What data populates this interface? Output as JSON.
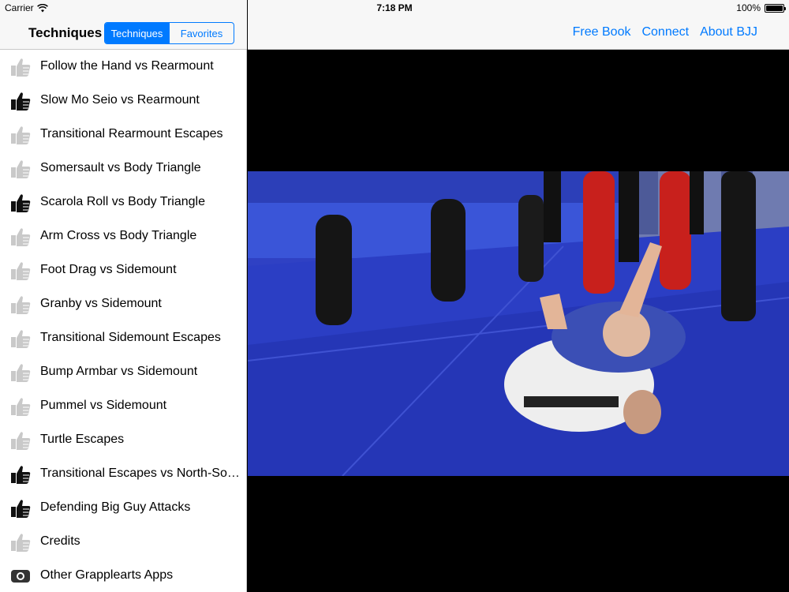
{
  "status_bar": {
    "carrier": "Carrier",
    "time": "7:18 PM",
    "battery": "100%"
  },
  "sidebar": {
    "title": "Techniques",
    "segments": [
      {
        "label": "Techniques",
        "selected": true
      },
      {
        "label": "Favorites",
        "selected": false
      }
    ],
    "items": [
      {
        "label": "Follow the Hand vs Rearmount",
        "icon": "thumbs-up-icon",
        "favorited": false
      },
      {
        "label": "Slow Mo Seio vs Rearmount",
        "icon": "thumbs-up-icon",
        "favorited": true
      },
      {
        "label": "Transitional Rearmount Escapes",
        "icon": "thumbs-up-icon",
        "favorited": false
      },
      {
        "label": "Somersault vs Body Triangle",
        "icon": "thumbs-up-icon",
        "favorited": false
      },
      {
        "label": "Scarola Roll vs Body Triangle",
        "icon": "thumbs-up-icon",
        "favorited": true
      },
      {
        "label": "Arm Cross vs Body Triangle",
        "icon": "thumbs-up-icon",
        "favorited": false
      },
      {
        "label": "Foot Drag vs Sidemount",
        "icon": "thumbs-up-icon",
        "favorited": false
      },
      {
        "label": "Granby vs Sidemount",
        "icon": "thumbs-up-icon",
        "favorited": false
      },
      {
        "label": "Transitional Sidemount Escapes",
        "icon": "thumbs-up-icon",
        "favorited": false
      },
      {
        "label": "Bump Armbar vs Sidemount",
        "icon": "thumbs-up-icon",
        "favorited": false
      },
      {
        "label": "Pummel vs Sidemount",
        "icon": "thumbs-up-icon",
        "favorited": false
      },
      {
        "label": "Turtle Escapes",
        "icon": "thumbs-up-icon",
        "favorited": false
      },
      {
        "label": "Transitional Escapes vs North-South",
        "icon": "thumbs-up-icon",
        "favorited": true
      },
      {
        "label": "Defending Big Guy Attacks",
        "icon": "thumbs-up-icon",
        "favorited": true
      },
      {
        "label": "Credits",
        "icon": "thumbs-up-icon",
        "favorited": false
      },
      {
        "label": "Other Grapplearts Apps",
        "icon": "camera-icon",
        "favorited": false
      }
    ]
  },
  "detail": {
    "links": [
      "Free Book",
      "Connect",
      "About BJJ"
    ]
  },
  "colors": {
    "accent": "#007aff",
    "mat_blue": "#2f41c4",
    "icon_active": "#111111",
    "icon_inactive": "#c9c9c9"
  }
}
